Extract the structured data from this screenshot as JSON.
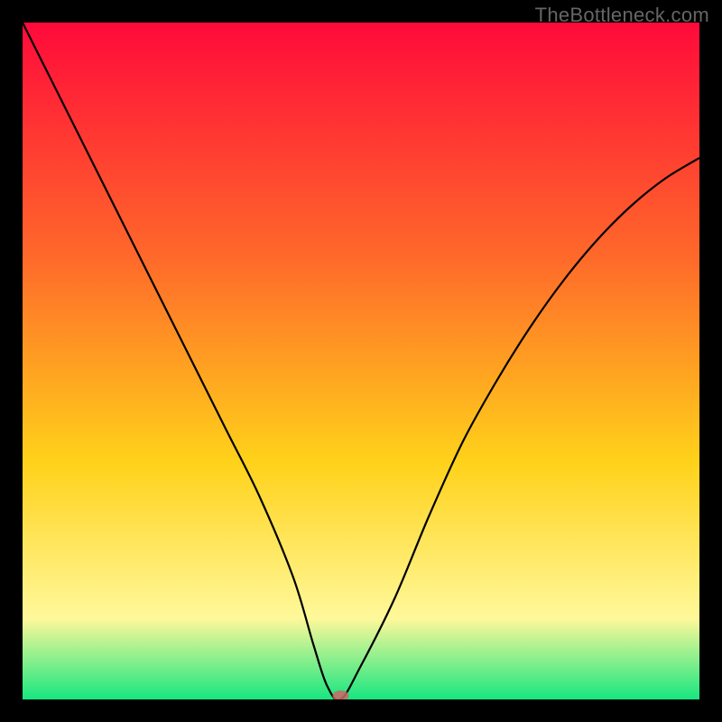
{
  "watermark": "TheBottleneck.com",
  "chart_data": {
    "type": "line",
    "title": "",
    "xlabel": "",
    "ylabel": "",
    "xlim": [
      0,
      100
    ],
    "ylim": [
      0,
      100
    ],
    "background_gradient": {
      "top": "#ff0a3a",
      "mid1": "#ff6a2a",
      "mid2": "#ffd21a",
      "mid3": "#fff89a",
      "bottom": "#17e680"
    },
    "series": [
      {
        "name": "bottleneck-curve",
        "x": [
          0,
          5,
          10,
          15,
          20,
          25,
          30,
          35,
          40,
          43,
          45,
          47,
          50,
          55,
          60,
          65,
          70,
          75,
          80,
          85,
          90,
          95,
          100
        ],
        "values": [
          100,
          90,
          80,
          70,
          60,
          50,
          40,
          30,
          18,
          8,
          2,
          0,
          5,
          15,
          27,
          38,
          47,
          55,
          62,
          68,
          73,
          77,
          80
        ]
      }
    ],
    "marker": {
      "x": 47,
      "y": 0,
      "name": "optimal-point"
    },
    "grid": false,
    "legend": false
  }
}
